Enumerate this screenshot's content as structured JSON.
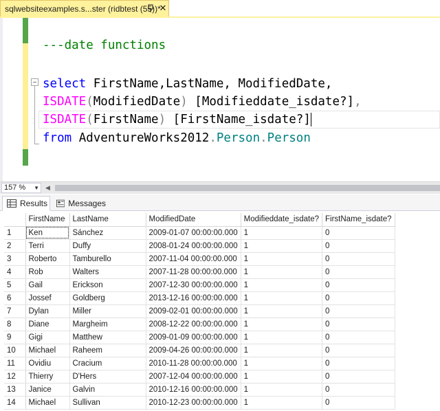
{
  "tab": {
    "title": "sqlwebsiteexamples.s...ster (ridbtest (55))*",
    "close_glyph": "✕",
    "pin_icon": "pin-icon"
  },
  "editor": {
    "comment": "---date functions",
    "line1": {
      "kw_select": "select",
      "cols": " FirstName,LastName, ModifiedDate,"
    },
    "line2": {
      "fn": "ISDATE",
      "open": "(",
      "arg": "ModifiedDate",
      "close": ")",
      "alias": " [Modifieddate_isdate?]",
      "comma": ","
    },
    "line3": {
      "fn": "ISDATE",
      "open": "(",
      "arg": "FirstName",
      "close": ")",
      "alias": " [FirstName_isdate?]"
    },
    "line4": {
      "kw_from": "from",
      "db": " AdventureWorks2012",
      "dot1": ".",
      "schema": "Person",
      "dot2": ".",
      "table": "Person"
    }
  },
  "zoom": {
    "value": "157 %"
  },
  "results_tabs": {
    "results": "Results",
    "messages": "Messages"
  },
  "grid": {
    "columns": [
      "FirstName",
      "LastName",
      "ModifiedDate",
      "Modifieddate_isdate?",
      "FirstName_isdate?"
    ],
    "rows": [
      [
        "1",
        "Ken",
        "Sánchez",
        "2009-01-07 00:00:00.000",
        "1",
        "0"
      ],
      [
        "2",
        "Terri",
        "Duffy",
        "2008-01-24 00:00:00.000",
        "1",
        "0"
      ],
      [
        "3",
        "Roberto",
        "Tamburello",
        "2007-11-04 00:00:00.000",
        "1",
        "0"
      ],
      [
        "4",
        "Rob",
        "Walters",
        "2007-11-28 00:00:00.000",
        "1",
        "0"
      ],
      [
        "5",
        "Gail",
        "Erickson",
        "2007-12-30 00:00:00.000",
        "1",
        "0"
      ],
      [
        "6",
        "Jossef",
        "Goldberg",
        "2013-12-16 00:00:00.000",
        "1",
        "0"
      ],
      [
        "7",
        "Dylan",
        "Miller",
        "2009-02-01 00:00:00.000",
        "1",
        "0"
      ],
      [
        "8",
        "Diane",
        "Margheim",
        "2008-12-22 00:00:00.000",
        "1",
        "0"
      ],
      [
        "9",
        "Gigi",
        "Matthew",
        "2009-01-09 00:00:00.000",
        "1",
        "0"
      ],
      [
        "10",
        "Michael",
        "Raheem",
        "2009-04-26 00:00:00.000",
        "1",
        "0"
      ],
      [
        "11",
        "Ovidiu",
        "Cracium",
        "2010-11-28 00:00:00.000",
        "1",
        "0"
      ],
      [
        "12",
        "Thierry",
        "D'Hers",
        "2007-12-04 00:00:00.000",
        "1",
        "0"
      ],
      [
        "13",
        "Janice",
        "Galvin",
        "2010-12-16 00:00:00.000",
        "1",
        "0"
      ],
      [
        "14",
        "Michael",
        "Sullivan",
        "2010-12-23 00:00:00.000",
        "1",
        "0"
      ]
    ]
  },
  "colors": {
    "tab_active": "#fff29d",
    "keyword": "#0000ff",
    "function": "#ff00ff",
    "comment": "#008000",
    "identifier_teal": "#008080"
  }
}
